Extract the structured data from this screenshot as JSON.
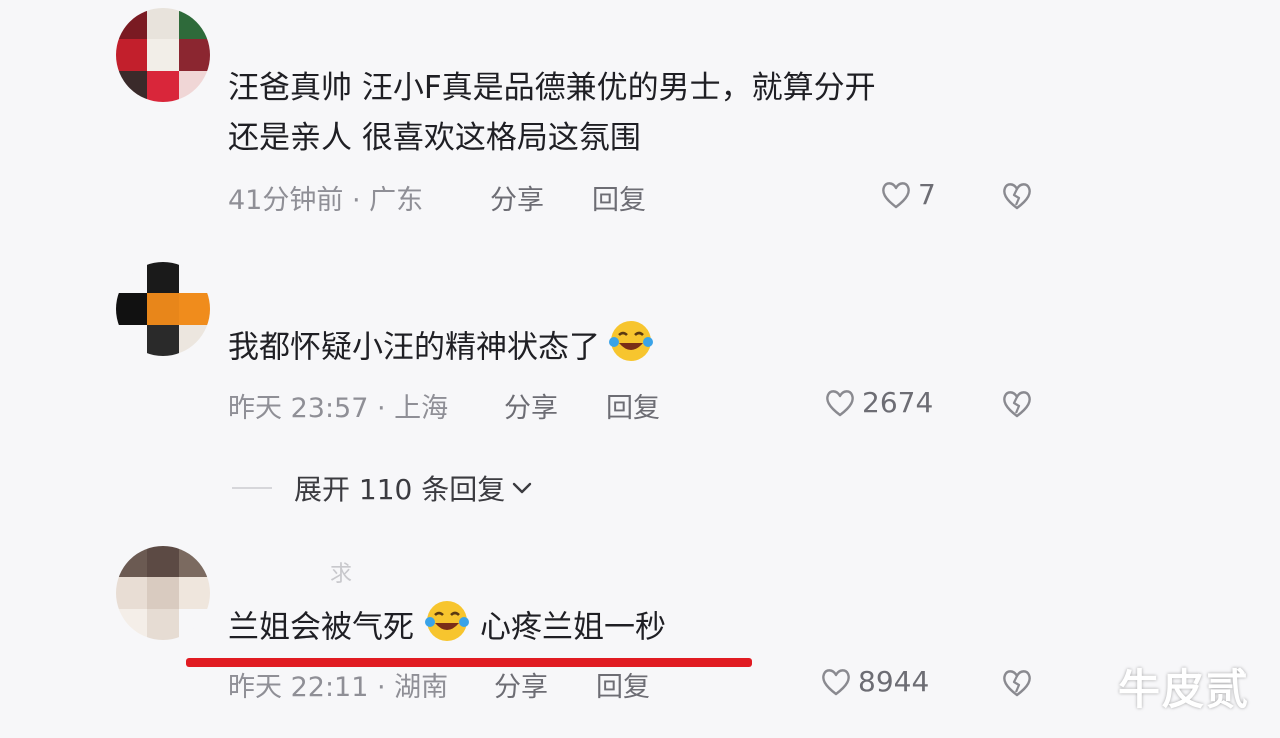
{
  "comments": [
    {
      "line1": "汪爸真帅  汪小F真是品德兼优的男士，就算分开",
      "line2": "还是亲人  很喜欢这格局这氛围",
      "time_location": "41分钟前 · 广东",
      "share": "分享",
      "reply": "回复",
      "likes": "7"
    },
    {
      "line1": "我都怀疑小汪的精神状态了",
      "time_location": "昨天 23:57 · 上海",
      "share": "分享",
      "reply": "回复",
      "likes": "2674",
      "expand_replies": "展开 110 条回复"
    },
    {
      "username_fragment": "求",
      "line1_a": "兰姐会被气死",
      "line1_b": "心疼兰姐一秒",
      "time_location": "昨天 22:11 · 湖南",
      "share": "分享",
      "reply": "回复",
      "likes": "8944"
    }
  ],
  "watermark": "牛皮贰",
  "colors": {
    "background": "#f7f7f9",
    "meta_text": "#8f8f96",
    "highlight_underline": "#e11b22"
  },
  "icons": [
    "heart-outline-icon",
    "broken-heart-icon",
    "laughing-crying-emoji",
    "chevron-down-icon"
  ]
}
